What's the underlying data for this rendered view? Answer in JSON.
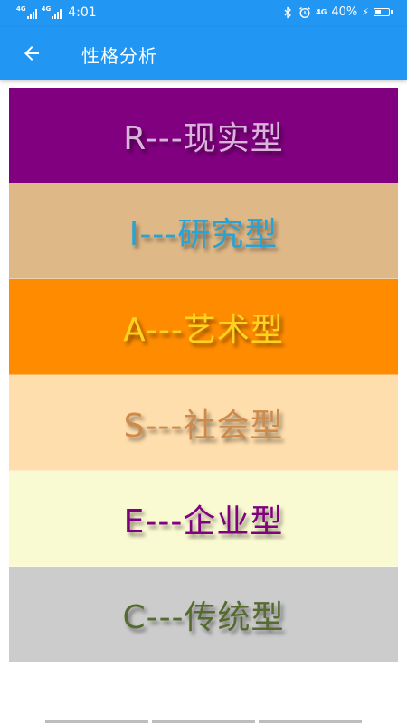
{
  "status_bar": {
    "network1": "4G",
    "network2": "4G",
    "time": "4:01",
    "network3": "4G",
    "battery_text": "40%",
    "battery_level": 0.4
  },
  "app_bar": {
    "back_icon": "arrow-back-icon",
    "title": "性格分析"
  },
  "types": [
    {
      "label": "R---现实型",
      "bg": "#800080",
      "fg": "#d9b3d9"
    },
    {
      "label": "I---研究型",
      "bg": "#deb887",
      "fg": "#29a3d6"
    },
    {
      "label": "A---艺术型",
      "bg": "#ff8c00",
      "fg": "#ffd21f"
    },
    {
      "label": "S---社会型",
      "bg": "#ffdead",
      "fg": "#cd8a4a"
    },
    {
      "label": "E---企业型",
      "bg": "#fafad2",
      "fg": "#800080"
    },
    {
      "label": "C---传统型",
      "bg": "#cccccc",
      "fg": "#556b2f"
    }
  ],
  "theme": {
    "primary": "#2196f3"
  }
}
